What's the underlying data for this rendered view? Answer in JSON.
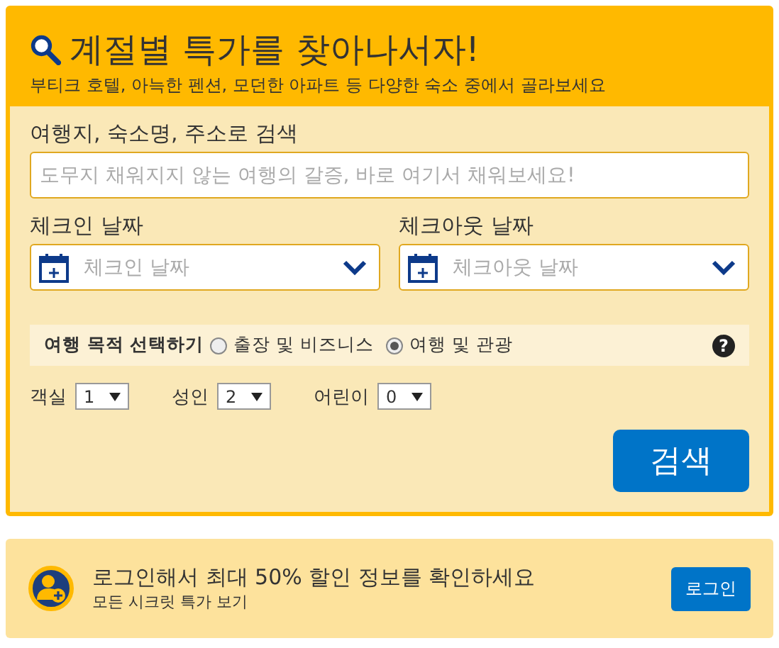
{
  "header": {
    "title": "계절별 특가를 찾아나서자!",
    "subtitle": "부티크 호텔, 아늑한 펜션, 모던한 아파트 등 다양한 숙소 중에서 골라보세요"
  },
  "destination": {
    "label": "여행지, 숙소명, 주소로 검색",
    "placeholder": "도무지 채워지지 않는 여행의 갈증, 바로 여기서 채워보세요!"
  },
  "dates": [
    {
      "label": "체크인 날짜",
      "placeholder": "체크인 날짜"
    },
    {
      "label": "체크아웃 날짜",
      "placeholder": "체크아웃 날짜"
    }
  ],
  "purpose": {
    "label": "여행 목적 선택하기",
    "options": [
      {
        "label": "출장 및 비즈니스",
        "selected": false
      },
      {
        "label": "여행 및 관광",
        "selected": true
      }
    ],
    "help": "?"
  },
  "counts": [
    {
      "label": "객실",
      "value": "1"
    },
    {
      "label": "성인",
      "value": "2"
    },
    {
      "label": "어린이",
      "value": "0"
    }
  ],
  "search_button": "검색",
  "login_banner": {
    "title": "로그인해서 최대 50% 할인 정보를 확인하세요",
    "subtitle": "모든 시크릿 특가 보기",
    "button": "로그인"
  }
}
